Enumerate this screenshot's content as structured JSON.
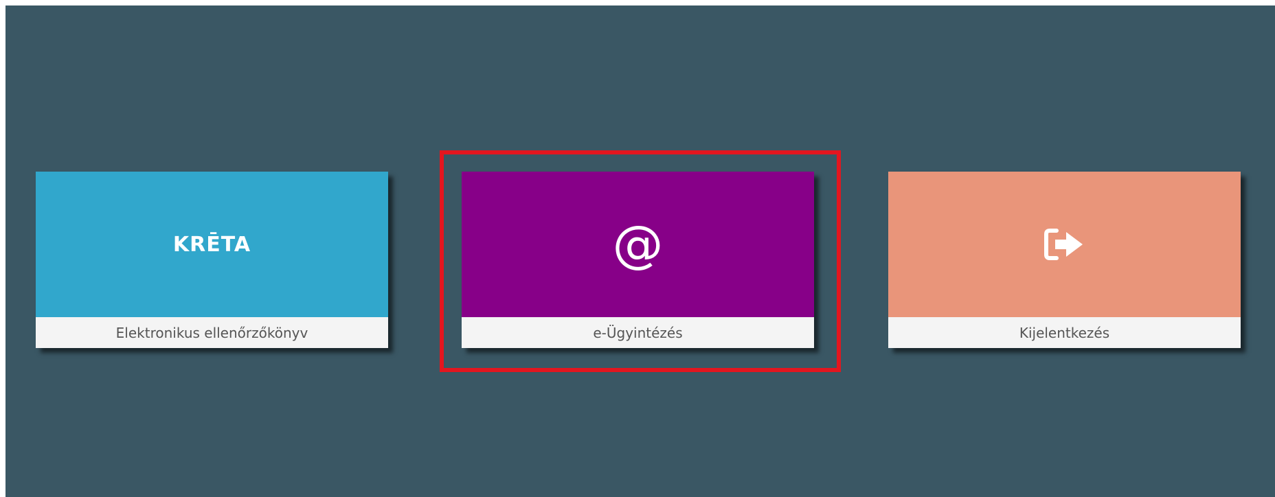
{
  "tiles": [
    {
      "label": "Elektronikus ellenőrzőkönyv",
      "logo_text": "KRĒTA",
      "icon": "kreta-logo",
      "color": "#31a7cc"
    },
    {
      "label": "e-Ügyintézés",
      "icon": "at-sign-icon",
      "icon_glyph": "@",
      "color": "#870088"
    },
    {
      "label": "Kijelentkezés",
      "icon": "sign-out-icon",
      "color": "#e9957a"
    }
  ],
  "highlight": {
    "color": "#e3161f",
    "target": "e-Ügyintézés"
  },
  "background_color": "#3a5764"
}
